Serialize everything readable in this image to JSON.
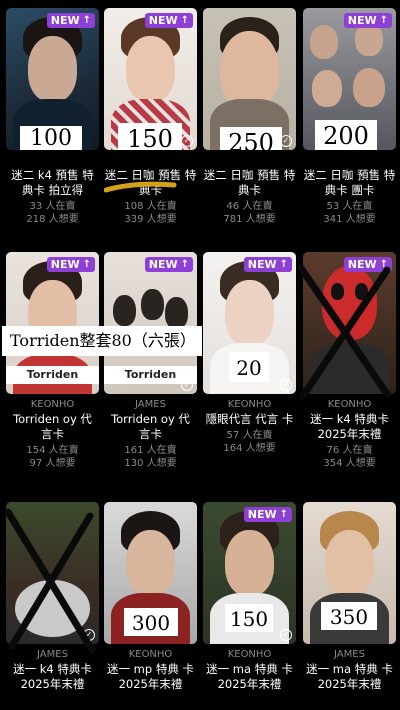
{
  "badge_label": "NEW",
  "row1": [
    {
      "member": "",
      "title": "迷二 k4 預售 特典卡 拍立得",
      "sell": "33 人在賣",
      "want": "218 人想要",
      "price": "100",
      "new": true
    },
    {
      "member": "",
      "title": "迷二 日咖 預售 特典卡",
      "sell": "108 人在賣",
      "want": "339 人想要",
      "price": "150",
      "new": true
    },
    {
      "member": "",
      "title": "迷二 日咖 預售 特典卡",
      "sell": "46 人在賣",
      "want": "781 人想要",
      "price": "250",
      "new": false
    },
    {
      "member": "",
      "title": "迷二 日咖 預售 特典卡 團卡",
      "sell": "53 人在賣",
      "want": "341 人想要",
      "price": "200",
      "new": true
    }
  ],
  "row2": [
    {
      "member": "KEONHO",
      "title": "Torriden oy 代 言卡",
      "sell": "154 人在賣",
      "want": "97 人想要",
      "brand": "Torriden",
      "new": true
    },
    {
      "member": "JAMES",
      "title": "Torriden oy 代 言卡",
      "sell": "161 人在賣",
      "want": "130 人想要",
      "brand": "Torriden",
      "new": true
    },
    {
      "member": "KEONHO",
      "title": "隱眼代言 代言 卡",
      "sell": "57 人在賣",
      "want": "164 人想要",
      "price": "20",
      "new": true
    },
    {
      "member": "KEONHO",
      "title": "迷一 k4 特典卡 2025年末禮",
      "sell": "76 人在賣",
      "want": "354 人想要",
      "new": true
    }
  ],
  "row2_overlay": "Torriden整套80（六張）",
  "row3": [
    {
      "member": "JAMES",
      "title": "迷一 k4 特典卡 2025年末禮",
      "price": "",
      "new": false
    },
    {
      "member": "KEONHO",
      "title": "迷一 mp 特典 卡 2025年末禮",
      "price": "300",
      "new": false
    },
    {
      "member": "KEONHO",
      "title": "迷一 ma 特典 卡 2025年末禮",
      "price": "150",
      "new": true
    },
    {
      "member": "JAMES",
      "title": "迷一 ma 特典 卡 2025年末禮",
      "price": "350",
      "new": false
    }
  ],
  "colors": {
    "badge": "#8e3fd6",
    "bg": "#000000",
    "muted": "#8a8a8a"
  }
}
